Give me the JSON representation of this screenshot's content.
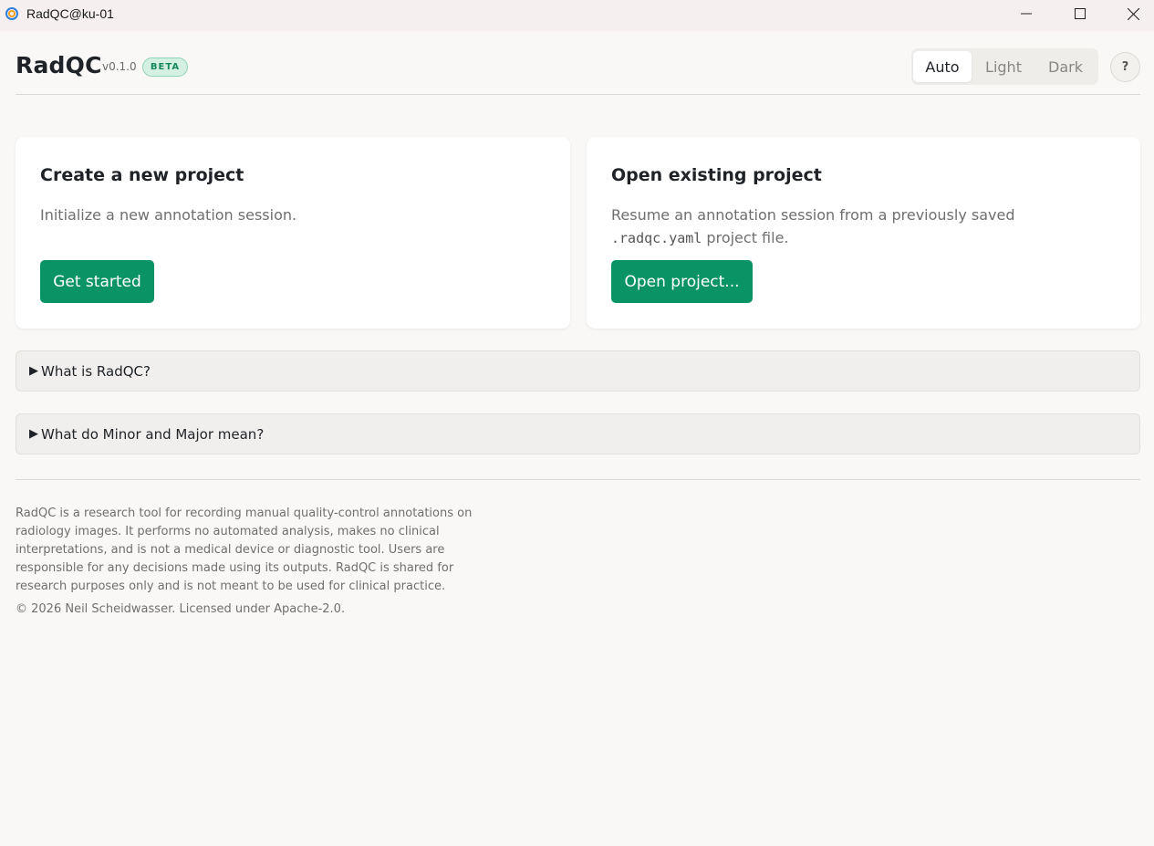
{
  "window": {
    "title": "RadQC@ku-01",
    "icon": "app-icon"
  },
  "header": {
    "brand": "RadQC",
    "version": "v0.1.0",
    "badge": "BETA",
    "theme_options": [
      "Auto",
      "Light",
      "Dark"
    ],
    "selected_theme": "Auto",
    "help_label": "?"
  },
  "cards": {
    "new_project": {
      "title": "Create a new project",
      "description": "Initialize a new annotation session.",
      "button_label": "Get started"
    },
    "open_project": {
      "title": "Open existing project",
      "description_before": "Resume an annotation session from a previously saved",
      "filename": ".radqc.yaml",
      "description_after": " project file.",
      "button_label": "Open project..."
    }
  },
  "accordions": [
    {
      "arrow": "▶",
      "label": "What is RadQC?"
    },
    {
      "arrow": "▶",
      "label": "What do Minor and Major mean?"
    }
  ],
  "footer": {
    "disclaimer": "RadQC is a research tool for recording manual quality-control annotations on radiology images. It performs no automated analysis, makes no clinical interpretations, and is not a medical device or diagnostic tool. Users are responsible for any decisions made using its outputs. RadQC is shared for research purposes only and is not meant to be used for clinical practice.",
    "copyright": "© 2026 Neil Scheidwasser. Licensed under Apache-2.0."
  },
  "colors": {
    "accent": "#0a9466",
    "background": "#f9f8f6",
    "badge_bg": "#d4f0e3",
    "badge_text": "#15885b"
  }
}
